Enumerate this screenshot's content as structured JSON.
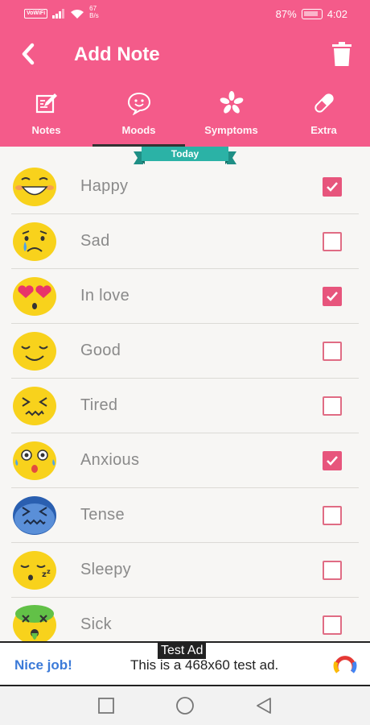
{
  "status_bar": {
    "network_tag": "VoWiFi",
    "net_speed_value": "67",
    "net_speed_unit": "B/s",
    "battery": "87%",
    "time": "4:02"
  },
  "app_bar": {
    "title": "Add Note",
    "back_icon": "chevron-left-icon",
    "delete_icon": "trash-icon"
  },
  "tabs": [
    {
      "label": "Notes",
      "icon": "edit-icon"
    },
    {
      "label": "Moods",
      "icon": "speech-smile-icon",
      "selected": true
    },
    {
      "label": "Symptoms",
      "icon": "flower-icon"
    },
    {
      "label": "Extra",
      "icon": "pill-icon"
    }
  ],
  "date_ribbon": "Today",
  "moods": [
    {
      "label": "Happy",
      "checked": true
    },
    {
      "label": "Sad",
      "checked": false
    },
    {
      "label": "In love",
      "checked": true
    },
    {
      "label": "Good",
      "checked": false
    },
    {
      "label": "Tired",
      "checked": false
    },
    {
      "label": "Anxious",
      "checked": true
    },
    {
      "label": "Tense",
      "checked": false
    },
    {
      "label": "Sleepy",
      "checked": false
    },
    {
      "label": "Sick",
      "checked": false
    }
  ],
  "ad": {
    "tag": "Test Ad",
    "left_text": "Nice job!",
    "text": "This is a 468x60 test ad."
  },
  "colors": {
    "primary": "#f45b8a",
    "teal": "#2bb2a6",
    "checkbox": "#e7557c"
  }
}
